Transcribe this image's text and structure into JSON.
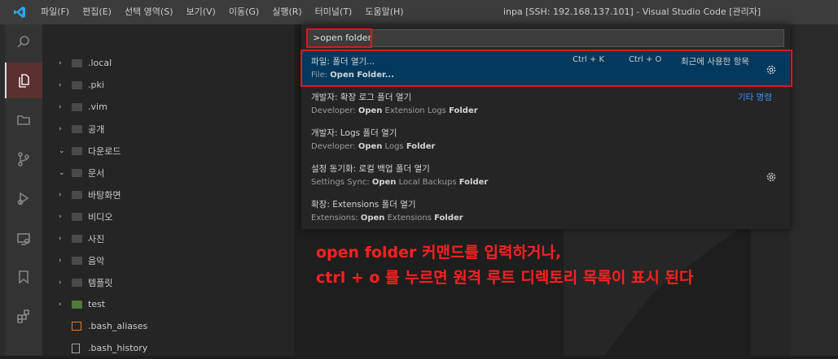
{
  "menu": [
    "파일(F)",
    "편집(E)",
    "선택 영역(S)",
    "보기(V)",
    "이동(G)",
    "실행(R)",
    "터미널(T)",
    "도움말(H)"
  ],
  "window_title": "inpa [SSH: 192.168.137.101] - Visual Studio Code [관리자]",
  "explorer": [
    {
      "label": ".local",
      "chevron": "›",
      "icon": "folder"
    },
    {
      "label": ".pki",
      "chevron": "›",
      "icon": "folder"
    },
    {
      "label": ".vim",
      "chevron": "›",
      "icon": "folder"
    },
    {
      "label": "공개",
      "chevron": "›",
      "icon": "folder"
    },
    {
      "label": "다운로드",
      "chevron": "⌄",
      "icon": "folder"
    },
    {
      "label": "문서",
      "chevron": "⌄",
      "icon": "folder"
    },
    {
      "label": "바탕화면",
      "chevron": "›",
      "icon": "folder"
    },
    {
      "label": "비디오",
      "chevron": "›",
      "icon": "folder"
    },
    {
      "label": "사진",
      "chevron": "›",
      "icon": "folder"
    },
    {
      "label": "음악",
      "chevron": "›",
      "icon": "folder"
    },
    {
      "label": "템플릿",
      "chevron": "›",
      "icon": "folder"
    },
    {
      "label": "test",
      "chevron": "›",
      "icon": "folder-green"
    },
    {
      "label": ".bash_aliases",
      "chevron": "",
      "icon": "terminal-file"
    },
    {
      "label": ".bash_history",
      "chevron": "",
      "icon": "file"
    }
  ],
  "palette": {
    "input_value": ">open folder",
    "items": [
      {
        "title": "파일: 폴더 열기...",
        "sub_prefix": "File: ",
        "sub_bold": "Open Folder...",
        "sub_suffix": ""
      },
      {
        "title": "개발자: 확장 로그 폴더 열기",
        "sub_prefix": "Developer: ",
        "sub_bold": "Open",
        "sub_suffix": " Extension Logs ",
        "sub_bold2": "Folder"
      },
      {
        "title": "개발자: Logs 폴더 열기",
        "sub_prefix": "Developer: ",
        "sub_bold": "Open",
        "sub_suffix": " Logs ",
        "sub_bold2": "Folder"
      },
      {
        "title": "설정 동기화: 로컬 백업 폴더 열기",
        "sub_prefix": "Settings Sync: ",
        "sub_bold": "Open",
        "sub_suffix": " Local Backups ",
        "sub_bold2": "Folder"
      },
      {
        "title": "확장: Extensions 폴더 열기",
        "sub_prefix": "Extensions: ",
        "sub_bold": "Open",
        "sub_suffix": " Extensions ",
        "sub_bold2": "Folder"
      }
    ],
    "keybinding_1": "Ctrl  +  K",
    "keybinding_2": "Ctrl  +  O",
    "recent_label": "최근에 사용한 항목",
    "other_label": "기타 명령"
  },
  "annotation": {
    "line1": "open folder 커맨드를 입력하거나,",
    "line2": "ctrl + o 를 누르면 원격 루트 디렉토리 목록이 표시 된다"
  },
  "colors": {
    "accent_red": "#e5141c",
    "link_blue": "#3794ff",
    "selection": "#04395e"
  }
}
